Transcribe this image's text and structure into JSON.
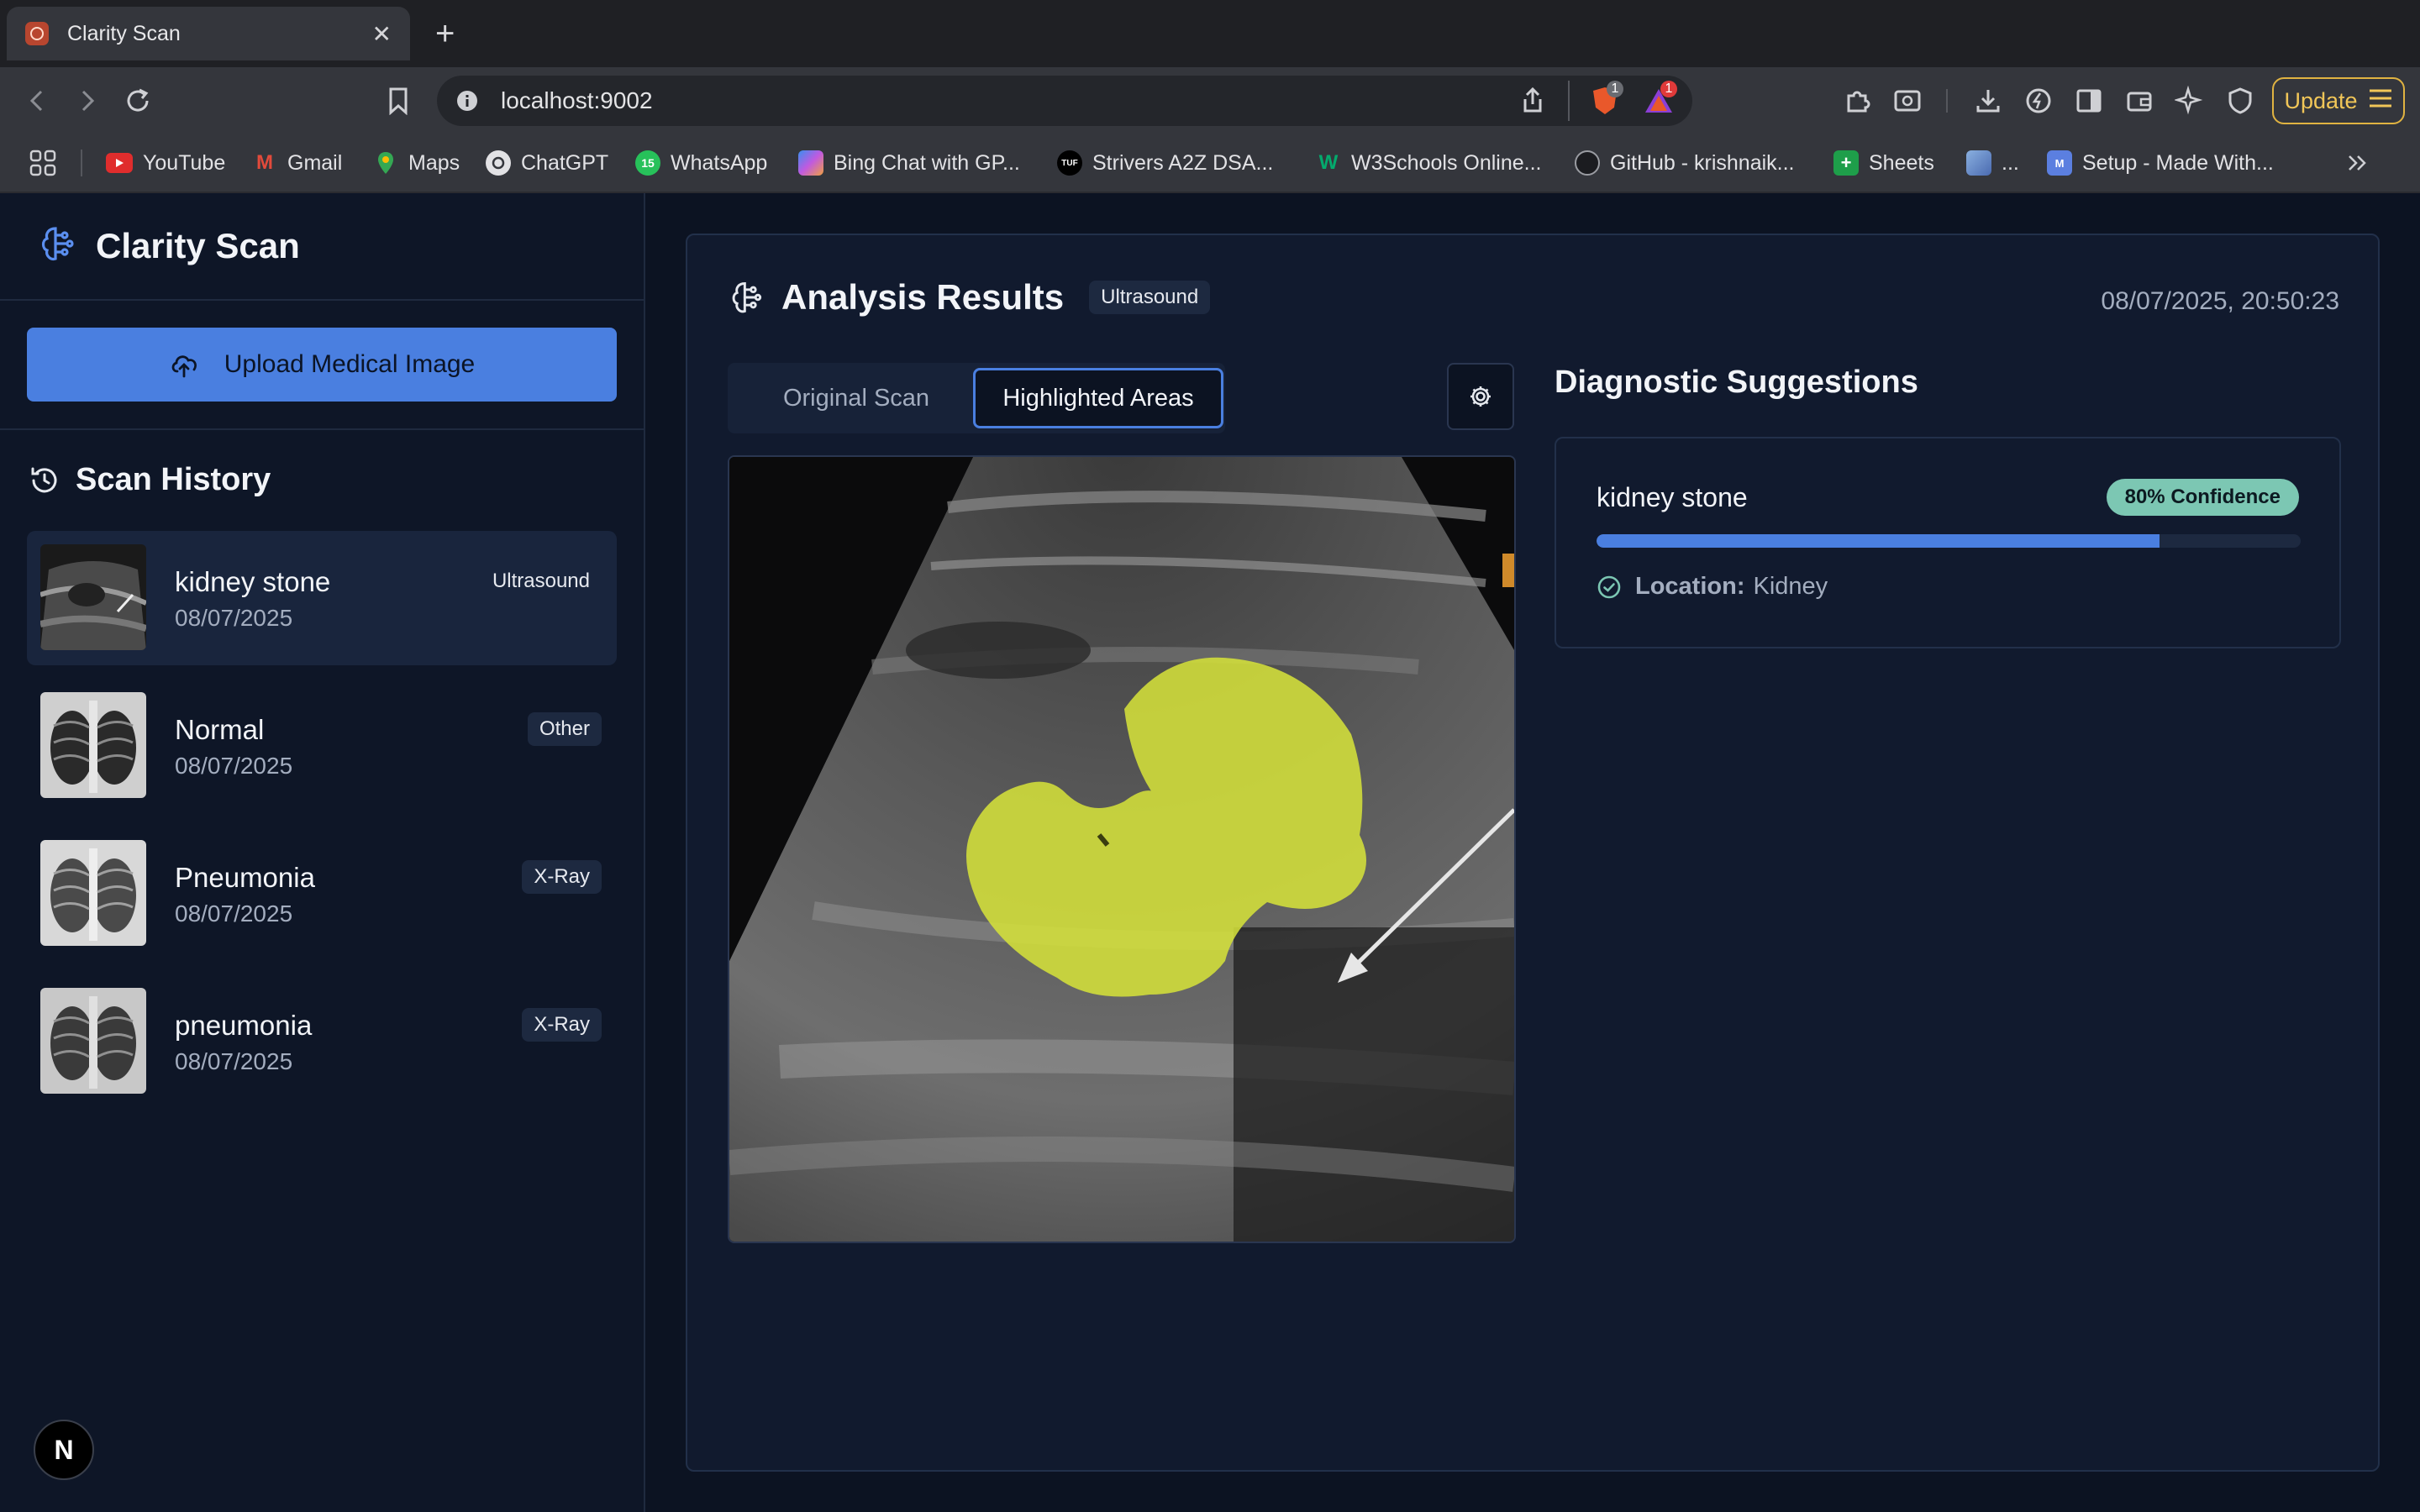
{
  "browser": {
    "tab_title": "Clarity Scan",
    "url": "localhost:9002",
    "update_label": "Update",
    "brave_badge": "1",
    "rewards_badge": "1",
    "bookmarks": [
      {
        "label": "YouTube"
      },
      {
        "label": "Gmail"
      },
      {
        "label": "Maps"
      },
      {
        "label": "ChatGPT"
      },
      {
        "label": "WhatsApp"
      },
      {
        "label": "Bing Chat with GP..."
      },
      {
        "label": "Strivers A2Z DSA..."
      },
      {
        "label": "W3Schools Online..."
      },
      {
        "label": "GitHub - krishnaik..."
      },
      {
        "label": "Sheets"
      },
      {
        "label": "..."
      },
      {
        "label": "Setup - Made With..."
      }
    ]
  },
  "sidebar": {
    "brand": "Clarity Scan",
    "upload_label": "Upload Medical Image",
    "history_title": "Scan History",
    "history": [
      {
        "name": "kidney stone",
        "date": "08/07/2025",
        "type": "Ultrasound"
      },
      {
        "name": "Normal",
        "date": "08/07/2025",
        "type": "Other"
      },
      {
        "name": "Pneumonia",
        "date": "08/07/2025",
        "type": "X-Ray"
      },
      {
        "name": "pneumonia",
        "date": "08/07/2025",
        "type": "X-Ray"
      }
    ],
    "next_badge": "N"
  },
  "results": {
    "title": "Analysis Results",
    "modality": "Ultrasound",
    "timestamp": "08/07/2025, 20:50:23",
    "tabs": [
      {
        "label": "Original Scan"
      },
      {
        "label": "Highlighted Areas"
      }
    ],
    "diagnostics_title": "Diagnostic Suggestions",
    "suggestion": {
      "name": "kidney stone",
      "confidence_label": "80% Confidence",
      "confidence": 0.8,
      "location_label": "Location:",
      "location": "Kidney"
    }
  },
  "colors": {
    "accent": "#4a7fe0",
    "confidence_badge": "#7cc7b3",
    "highlight": "#d4e03a"
  }
}
